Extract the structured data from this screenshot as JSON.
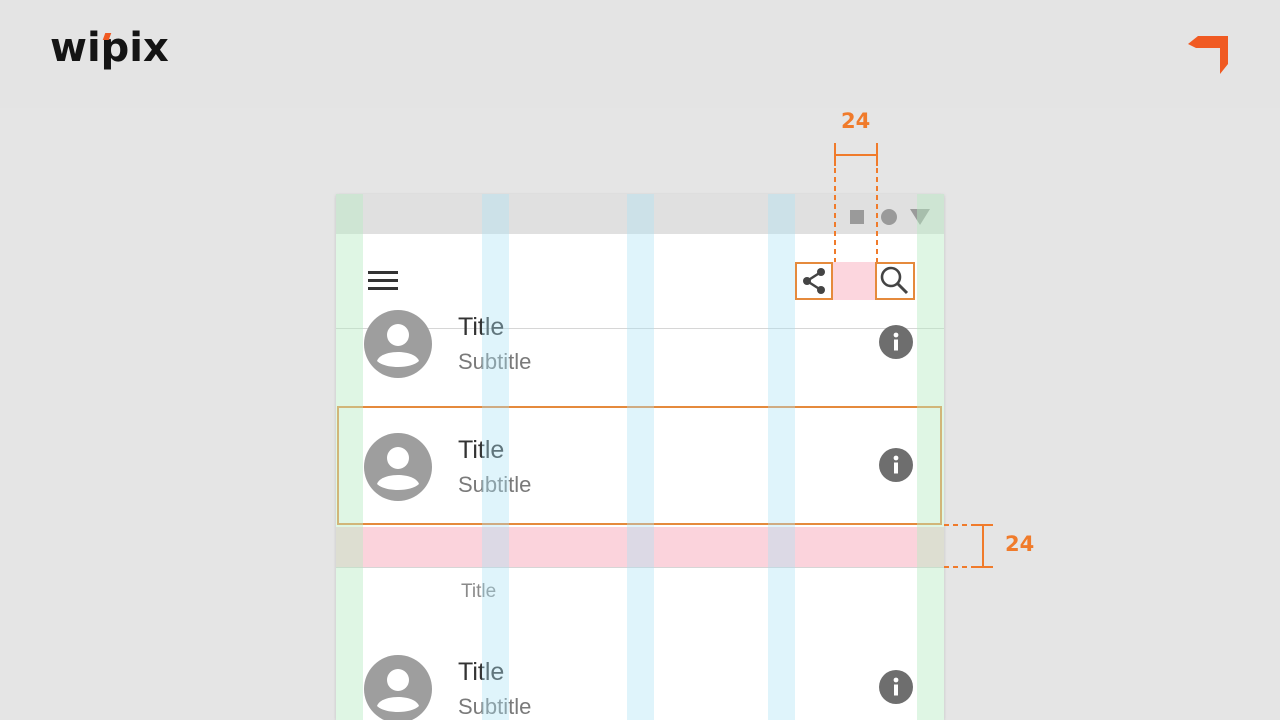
{
  "brand": {
    "name": "wipix",
    "accent_color": "#f05a22",
    "mark_icon": "corner-arrow-icon"
  },
  "phone": {
    "status_icons": [
      "square-icon",
      "circle-icon",
      "triangle-icon"
    ],
    "app_bar": {
      "menu_icon": "menu-icon",
      "actions": [
        "share-icon",
        "search-icon"
      ]
    },
    "list": {
      "rows": [
        {
          "title": "Title",
          "subtitle": "Subtitle",
          "trailing_icon": "info-icon"
        },
        {
          "title": "Title",
          "subtitle": "Subtitle",
          "trailing_icon": "info-icon"
        }
      ],
      "section_header": "Title",
      "section_rows": [
        {
          "title": "Title",
          "subtitle": "Subtitle",
          "trailing_icon": "info-icon"
        }
      ]
    }
  },
  "annotations": {
    "icon_gap": "24",
    "row_gap": "24",
    "color": "#f07b2b"
  },
  "colors": {
    "background": "#e5e5e5",
    "highlight": "#e58a3c",
    "spacing_fill": "#fbd3dc",
    "grid_margin": "#b8ecc4",
    "grid_column": "#abe2f5"
  }
}
